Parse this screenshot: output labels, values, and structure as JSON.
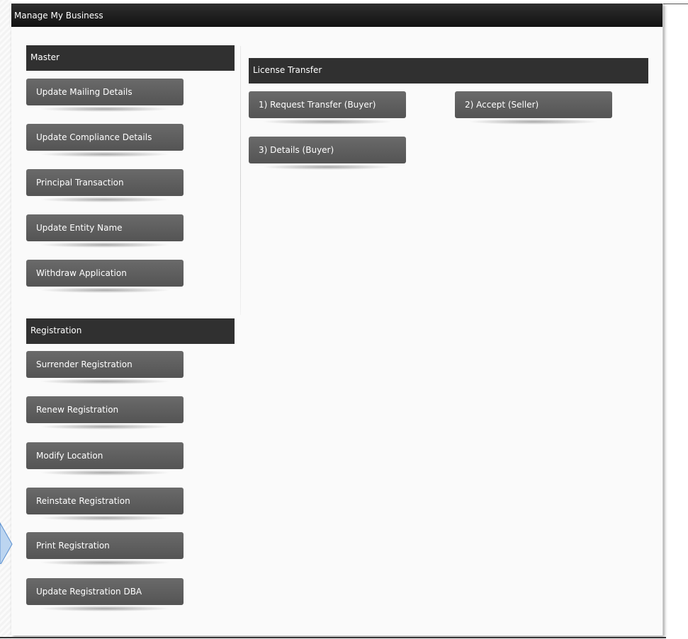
{
  "window": {
    "title": "Manage My Business"
  },
  "master": {
    "header": "Master",
    "buttons": [
      "Update Mailing Details",
      "Update Compliance Details",
      "Principal Transaction",
      "Update Entity Name",
      "Withdraw Application"
    ]
  },
  "registration": {
    "header": "Registration",
    "buttons": [
      "Surrender Registration",
      "Renew Registration",
      "Modify Location",
      "Reinstate Registration",
      "Print Registration",
      "Update Registration DBA"
    ]
  },
  "license_transfer": {
    "header": "License Transfer",
    "buttons": [
      "1) Request Transfer (Buyer)",
      "2) Accept (Seller)",
      "3) Details (Buyer)"
    ]
  },
  "colors": {
    "title_bar": "#1a1a1a",
    "section_header": "#303030",
    "button": "#5e5e5e",
    "arrow_fill": "#bcd5f0",
    "arrow_stroke": "#5a8fcf"
  },
  "icons": {
    "pointer_arrow": "arrow-right-icon"
  }
}
